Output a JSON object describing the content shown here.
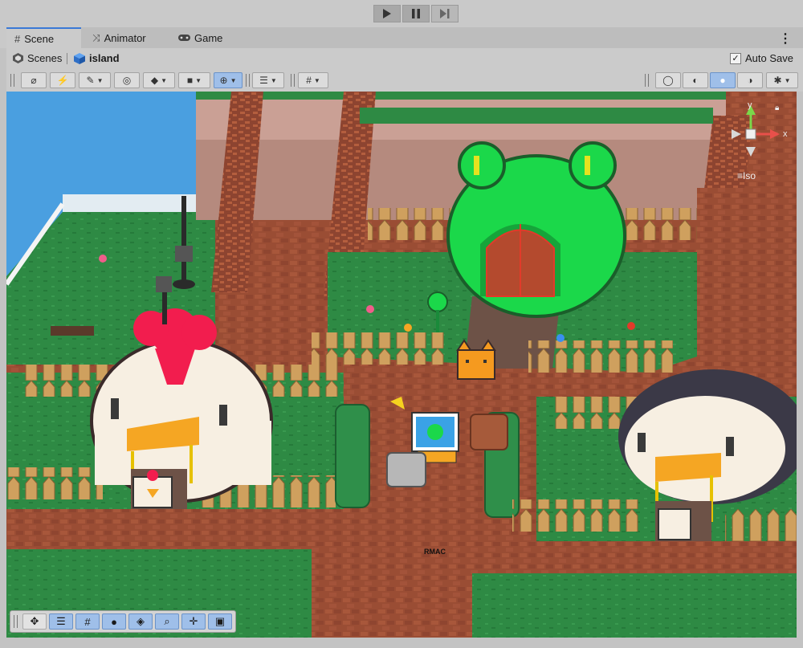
{
  "window": {
    "tabs": [
      {
        "label": "Scene",
        "icon": "grid-icon",
        "active": true
      },
      {
        "label": "Animator",
        "icon": "animator-icon",
        "active": false
      },
      {
        "label": "Game",
        "icon": "gamepad-icon",
        "active": false
      }
    ]
  },
  "breadcrumb": {
    "root": "Scenes",
    "current": "island"
  },
  "autosave": {
    "label": "Auto Save",
    "checked": true
  },
  "gizmo": {
    "axis_y": "y",
    "axis_x": "x",
    "projection": "Iso"
  },
  "scene": {
    "sign_text": "RMAC"
  },
  "colors": {
    "accent": "#3a79d6",
    "tool_active": "#9fbfe9",
    "water": "#4a9fe0",
    "grass": "#2e8a44",
    "brick": "#9a4d34",
    "frog_house": "#1bd84a",
    "door": "#b44a2e",
    "awning": "#f5a623",
    "fence": "#cfa05e"
  }
}
